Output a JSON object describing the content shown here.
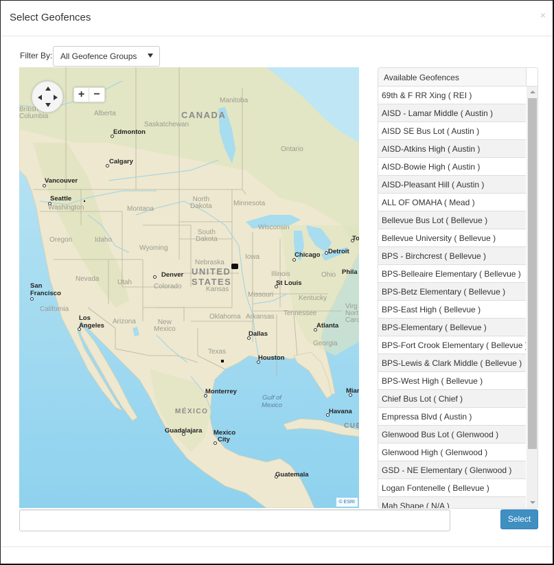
{
  "modal": {
    "title": "Select Geofences",
    "close_icon": "×"
  },
  "filter": {
    "label": "Filter By:",
    "selected": "All Geofence Groups"
  },
  "map": {
    "controls": {
      "zoom_in": "+",
      "zoom_out": "−"
    },
    "attribution": "© ESRI",
    "labels": {
      "countries": [
        "CANADA",
        "UNITED",
        "STATES",
        "MÉXICO",
        "CUB"
      ],
      "states": [
        "British",
        "Columbia",
        "Alberta",
        "Saskatchewan",
        "Manitoba",
        "Ontario",
        "Washington",
        "Montana",
        "North",
        "Dakota",
        "Minnesota",
        "South",
        "Dakota",
        "Wisconsin",
        "Oregon",
        "Idaho",
        "Wyoming",
        "Nebraska",
        "Iowa",
        "Illinois",
        "Ohio",
        "Nevada",
        "Utah",
        "Colorado",
        "Kansas",
        "Missouri",
        "Kentucky",
        "California",
        "Arizona",
        "New",
        "Mexico",
        "Oklahoma",
        "Arkansas",
        "Tennessee",
        "Texas",
        "Georgia",
        "Virg",
        "Nort",
        "Carol"
      ],
      "cities": [
        "Edmonton",
        "Calgary",
        "Vancouver",
        "Seattle",
        "Denver",
        "San",
        "Francisco",
        "Los",
        "Angeles",
        "Chicago",
        "Detroit",
        "To",
        "Phila",
        "St Louis",
        "Dallas",
        "Houston",
        "Atlanta",
        "Monterrey",
        "Guadalajara",
        "Mexico",
        "City",
        "Havana",
        "Mian",
        "Guatemala"
      ],
      "water": [
        "Gulf of",
        "Mexico"
      ]
    }
  },
  "geofences": {
    "header": "Available Geofences",
    "items": [
      "69th & F RR Xing ( REI )",
      "AISD - Lamar Middle ( Austin )",
      "AISD SE Bus Lot ( Austin )",
      "AISD-Atkins High ( Austin )",
      "AISD-Bowie High ( Austin )",
      "AISD-Pleasant Hill ( Austin )",
      "ALL OF OMAHA ( Mead )",
      "Bellevue Bus Lot ( Bellevue )",
      "Bellevue University ( Bellevue )",
      "BPS - Birchcrest ( Bellevue )",
      "BPS-Belleaire Elementary ( Bellevue )",
      "BPS-Betz Elementary ( Bellevue )",
      "BPS-East High ( Bellevue )",
      "BPS-Elementary ( Bellevue )",
      "BPS-Fort Crook Elementary ( Bellevue )",
      "BPS-Lewis & Clark Middle ( Bellevue )",
      "BPS-West High ( Bellevue )",
      "Chief Bus Lot ( Chief )",
      "Empressa Blvd ( Austin )",
      "Glenwood Bus Lot ( Glenwood )",
      "Glenwood High ( Glenwood )",
      "GSD - NE Elementary ( Glenwood )",
      "Logan Fontenelle ( Bellevue )",
      "Mah Shape ( N/A )"
    ]
  },
  "footer": {
    "name_input_value": "",
    "select_label": "Select"
  },
  "colors": {
    "primary_button": "#3f8fc1",
    "row_alt": "#f2f2f2",
    "land": "#efe9d1",
    "water": "#a8dcef"
  }
}
